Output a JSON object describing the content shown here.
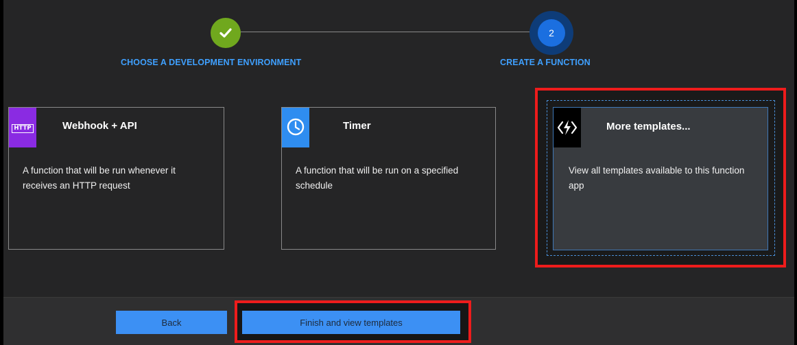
{
  "stepper": {
    "steps": [
      {
        "label": "CHOOSE A DEVELOPMENT ENVIRONMENT",
        "state": "completed",
        "icon": "checkmark-icon"
      },
      {
        "label": "CREATE A FUNCTION",
        "state": "current",
        "number": "2"
      }
    ]
  },
  "cards": [
    {
      "title": "Webhook + API",
      "description": "A function that will be run whenever it receives an HTTP request",
      "icon": "http-icon",
      "icon_text": "HTTP",
      "icon_color": "#8a2be2"
    },
    {
      "title": "Timer",
      "description": "A function that will be run on a specified schedule",
      "icon": "clock-icon",
      "icon_color": "#2f8df0"
    },
    {
      "title": "More templates...",
      "description": "View all templates available to this function app",
      "icon": "azure-functions-icon",
      "icon_color": "#000000",
      "selected": true
    }
  ],
  "footer": {
    "back_label": "Back",
    "finish_label": "Finish and view templates"
  },
  "colors": {
    "accent": "#3c90f4",
    "step_complete": "#70a81e",
    "step_current": "#1b6fe0",
    "highlight_annotation": "#ee1c1c"
  }
}
